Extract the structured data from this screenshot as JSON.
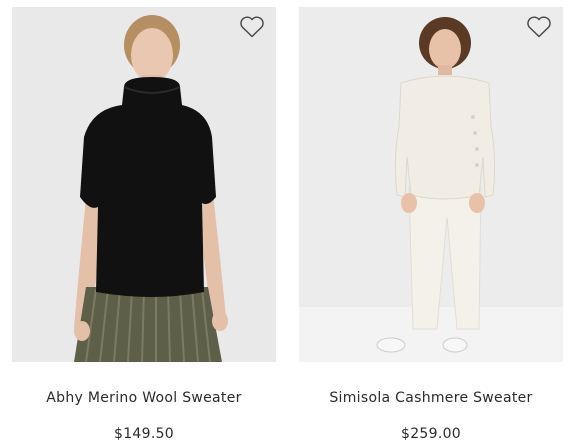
{
  "products": [
    {
      "name": "Abhy Merino Wool Sweater",
      "price": "$149.50",
      "wishlist_icon": "heart-outline-icon",
      "image_bg": "#e9e9e9",
      "garment_color": "#111111",
      "skirt_color": "#5e5f48"
    },
    {
      "name": "Simisola Cashmere Sweater",
      "price": "$259.00",
      "wishlist_icon": "heart-outline-icon",
      "image_bg": "#ececec",
      "garment_color": "#f1ede4",
      "pants_color": "#f3f1ea"
    }
  ]
}
